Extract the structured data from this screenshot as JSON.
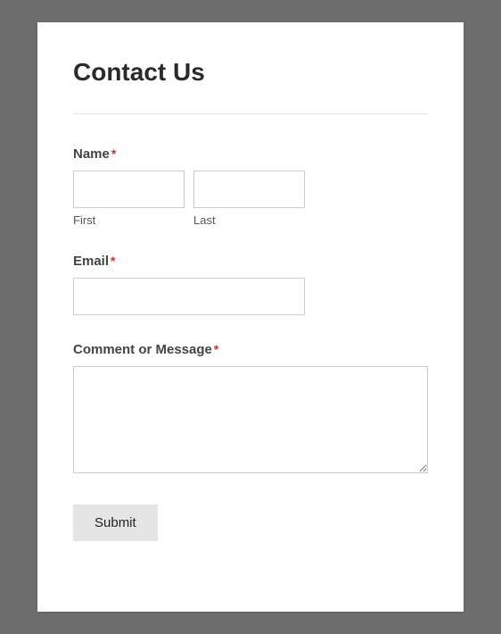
{
  "title": "Contact Us",
  "fields": {
    "name": {
      "label": "Name",
      "required_marker": "*",
      "first": {
        "value": "",
        "sublabel": "First"
      },
      "last": {
        "value": "",
        "sublabel": "Last"
      }
    },
    "email": {
      "label": "Email",
      "required_marker": "*",
      "value": ""
    },
    "message": {
      "label": "Comment or Message",
      "required_marker": "*",
      "value": ""
    }
  },
  "submit": {
    "label": "Submit"
  }
}
